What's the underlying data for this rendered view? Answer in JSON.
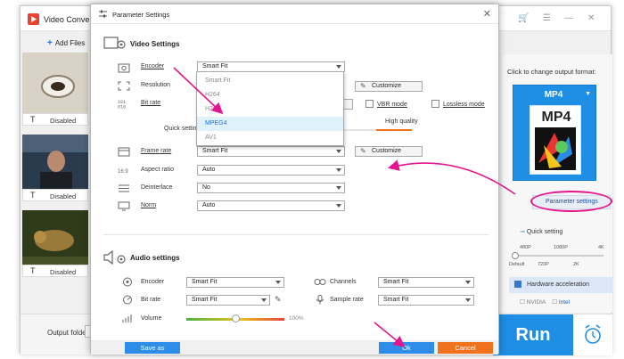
{
  "app": {
    "title": "Video Conve",
    "add_files": "Add Files",
    "subtitle_label": "Disabled",
    "subtitle_prefix": "T",
    "output_folder": "Output folder:",
    "run": "Run",
    "format_hint": "Click to change output format:",
    "format_name": "MP4",
    "format_icon_text": "MP4",
    "param_settings": "Parameter settings",
    "quick_setting": "Quick setting",
    "quick_ticks_top": [
      "480P",
      "1080P",
      "4K"
    ],
    "quick_ticks_bottom": [
      "Default",
      "720P",
      "2K"
    ],
    "hw_accel": "Hardware acceleration",
    "vendors": [
      "NVIDIA",
      "Intel"
    ]
  },
  "dialog": {
    "title": "Parameter Settings",
    "video_section": "Video Settings",
    "encoder_label": "Encoder",
    "encoder_value": "Smart Fit",
    "encoder_options": [
      "Smart Fit",
      "H264",
      "H265",
      "MPEG4",
      "AV1"
    ],
    "encoder_selected": "MPEG4",
    "resolution_label": "Resolution",
    "customize": "Customize",
    "bitrate_label": "Bit rate",
    "bitrate_partial": "ize",
    "vbr_mode": "VBR mode",
    "lossless_mode": "Lossless mode",
    "quick_setting_partial": "Quick settin",
    "high_quality": "High quality",
    "framerate_label": "Frame rate",
    "framerate_value": "Smart Fit",
    "aspect_label": "Aspect ratio",
    "aspect_value": "Auto",
    "deinterlace_label": "Deinterlace",
    "deinterlace_value": "No",
    "norm_label": "Norm",
    "norm_value": "Auto",
    "audio_section": "Audio settings",
    "audio_encoder_label": "Encoder",
    "audio_encoder_value": "Smart Fit",
    "channels_label": "Channels",
    "channels_value": "Smart Fit",
    "audio_bitrate_label": "Bit rate",
    "audio_bitrate_value": "Smart Fit",
    "sample_rate_label": "Sample rate",
    "sample_rate_value": "Smart Fit",
    "volume_label": "Volume",
    "volume_value": "100%",
    "volume_level": 0.5,
    "save_as": "Save as",
    "ok": "Ok",
    "cancel": "Cancel"
  },
  "colors": {
    "accent_blue": "#2d8de8",
    "cancel_orange": "#f2711c",
    "annotation_pink": "#e5168d"
  }
}
